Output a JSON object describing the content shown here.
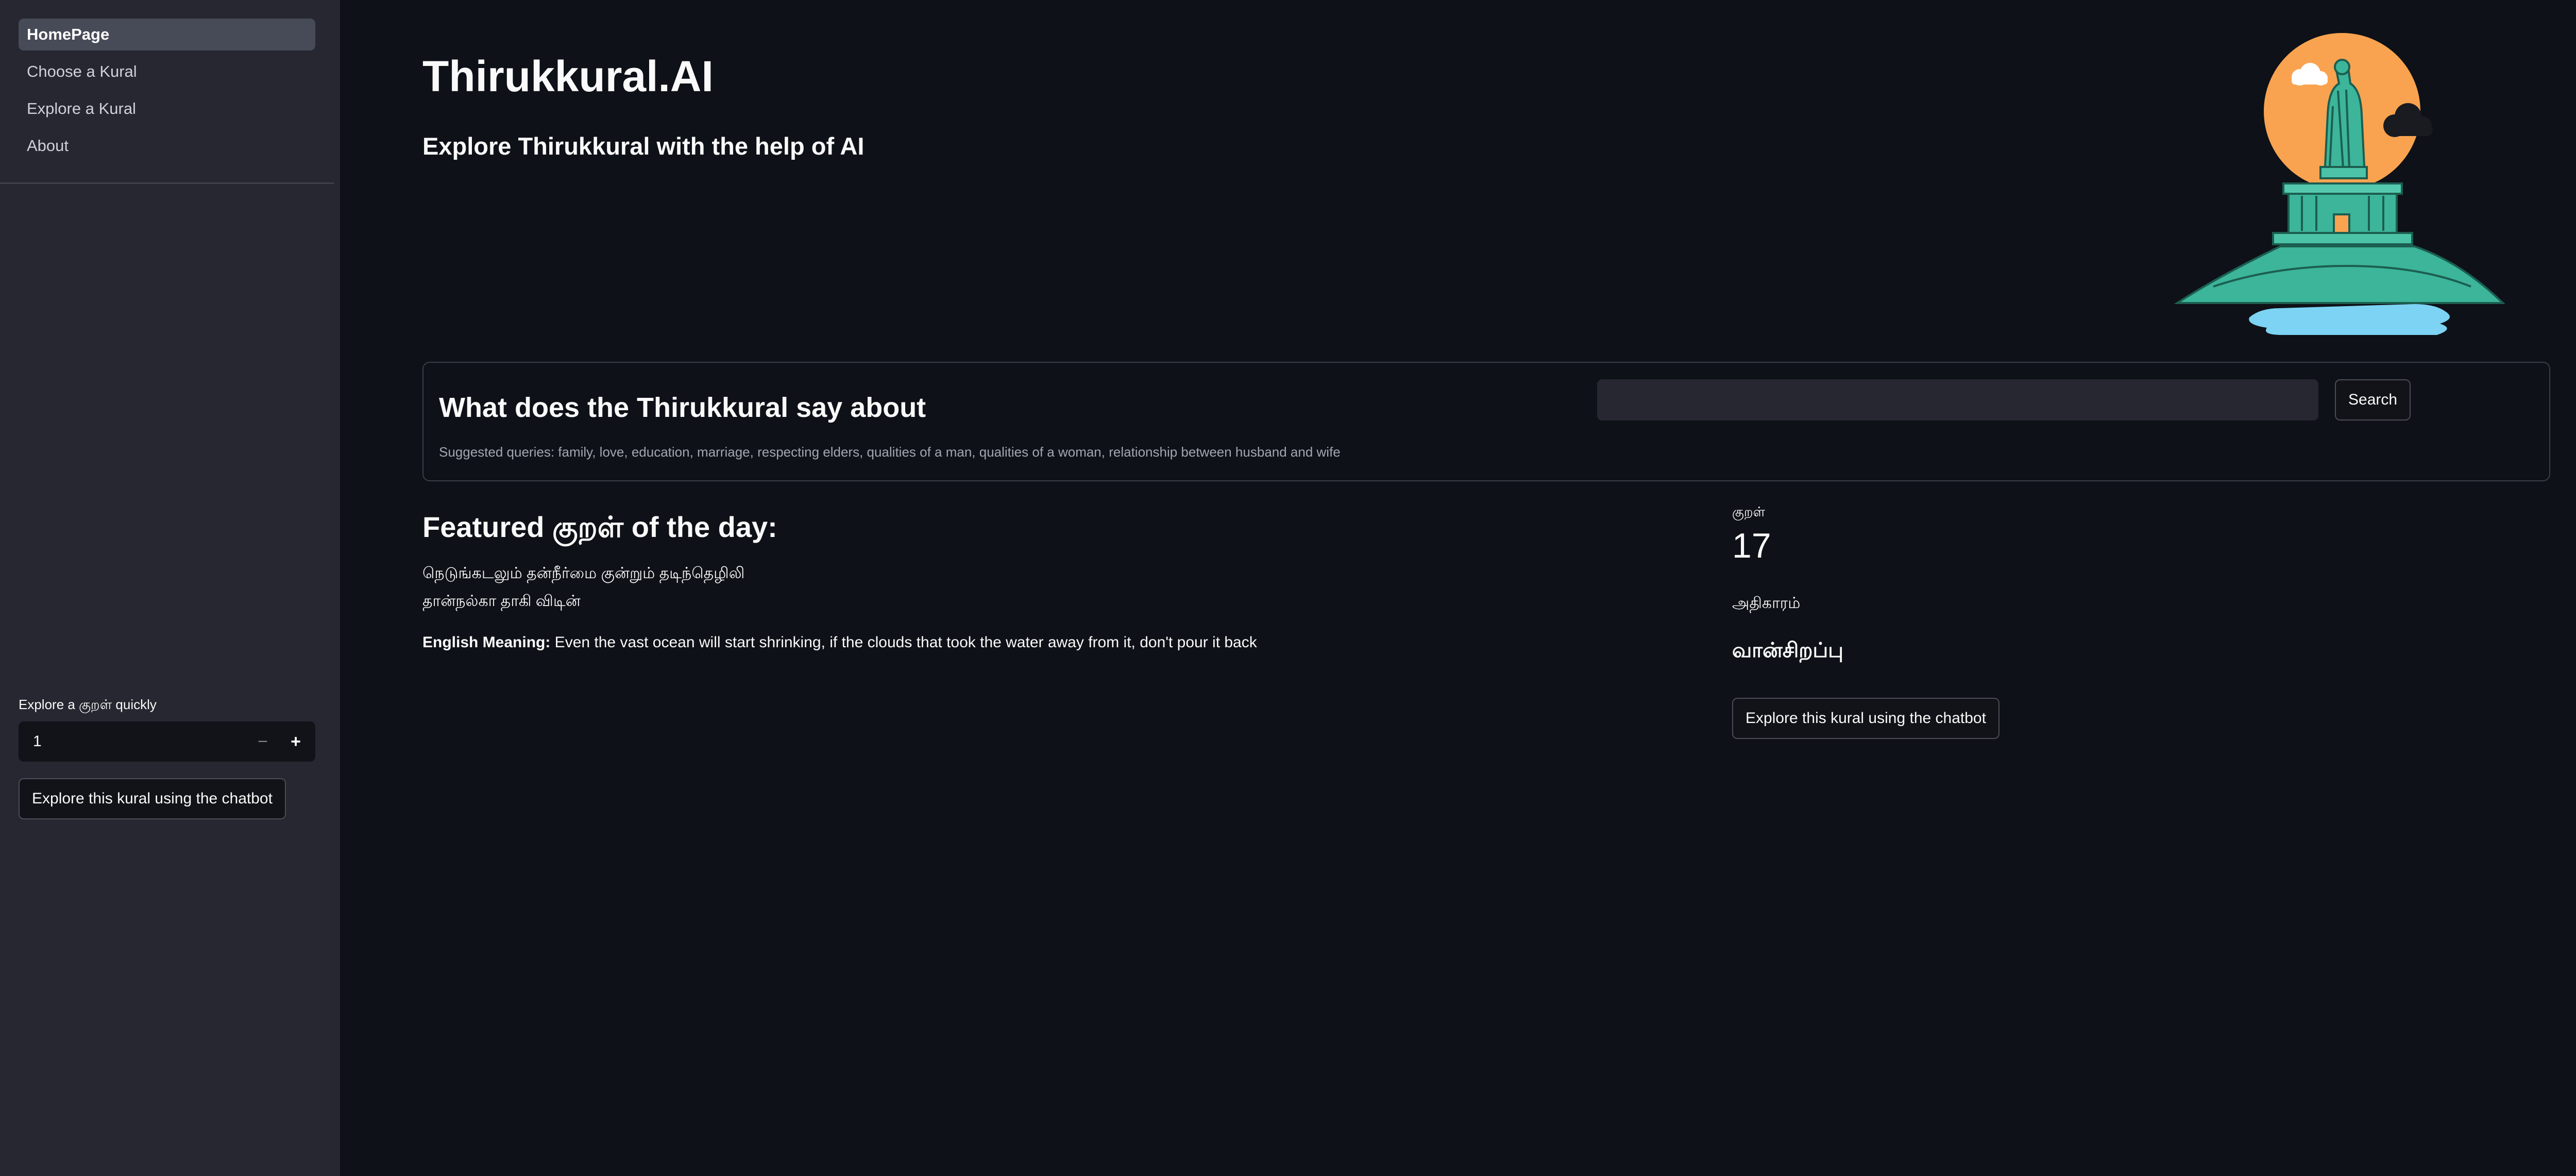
{
  "sidebar": {
    "nav": [
      {
        "label": "HomePage",
        "active": true
      },
      {
        "label": "Choose a Kural",
        "active": false
      },
      {
        "label": "Explore a Kural",
        "active": false
      },
      {
        "label": "About",
        "active": false
      }
    ],
    "quick_label": "Explore a குறள் quickly",
    "stepper_value": "1",
    "stepper_minus": "−",
    "stepper_plus": "+",
    "chatbot_button": "Explore this kural using the chatbot"
  },
  "header": {
    "title": "Thirukkural.AI",
    "subtitle": "Explore Thirukkural with the help of AI"
  },
  "search": {
    "heading": "What does the Thirukkural say about",
    "input_value": "",
    "button_label": "Search",
    "suggestions": "Suggested queries: family, love, education, marriage, respecting elders, qualities of a man, qualities of a woman, relationship between husband and wife"
  },
  "featured": {
    "title": "Featured குறள் of the day:",
    "line1": "நெடுங்கடலும் தன்நீர்மை குன்றும் தடிந்தெழிலி",
    "line2": "தான்நல்கா தாகி விடின்",
    "meaning_label": "English Meaning:",
    "meaning_text": " Even the vast ocean will start shrinking, if the clouds that took the water away from it, don't pour it back",
    "metric_label": "குறள்",
    "metric_value": "17",
    "chapter_label": "அதிகாரம்",
    "chapter_value": "வான்சிறப்பு",
    "chatbot_button": "Explore this kural using the chatbot"
  },
  "colors": {
    "background": "#0e1117",
    "sidebar": "#262730",
    "sun": "#f9a350",
    "statue": "#3cb59a",
    "water": "#7cd3f3"
  },
  "icons": {
    "hero": "thiruvalluvar-statue-illustration"
  }
}
